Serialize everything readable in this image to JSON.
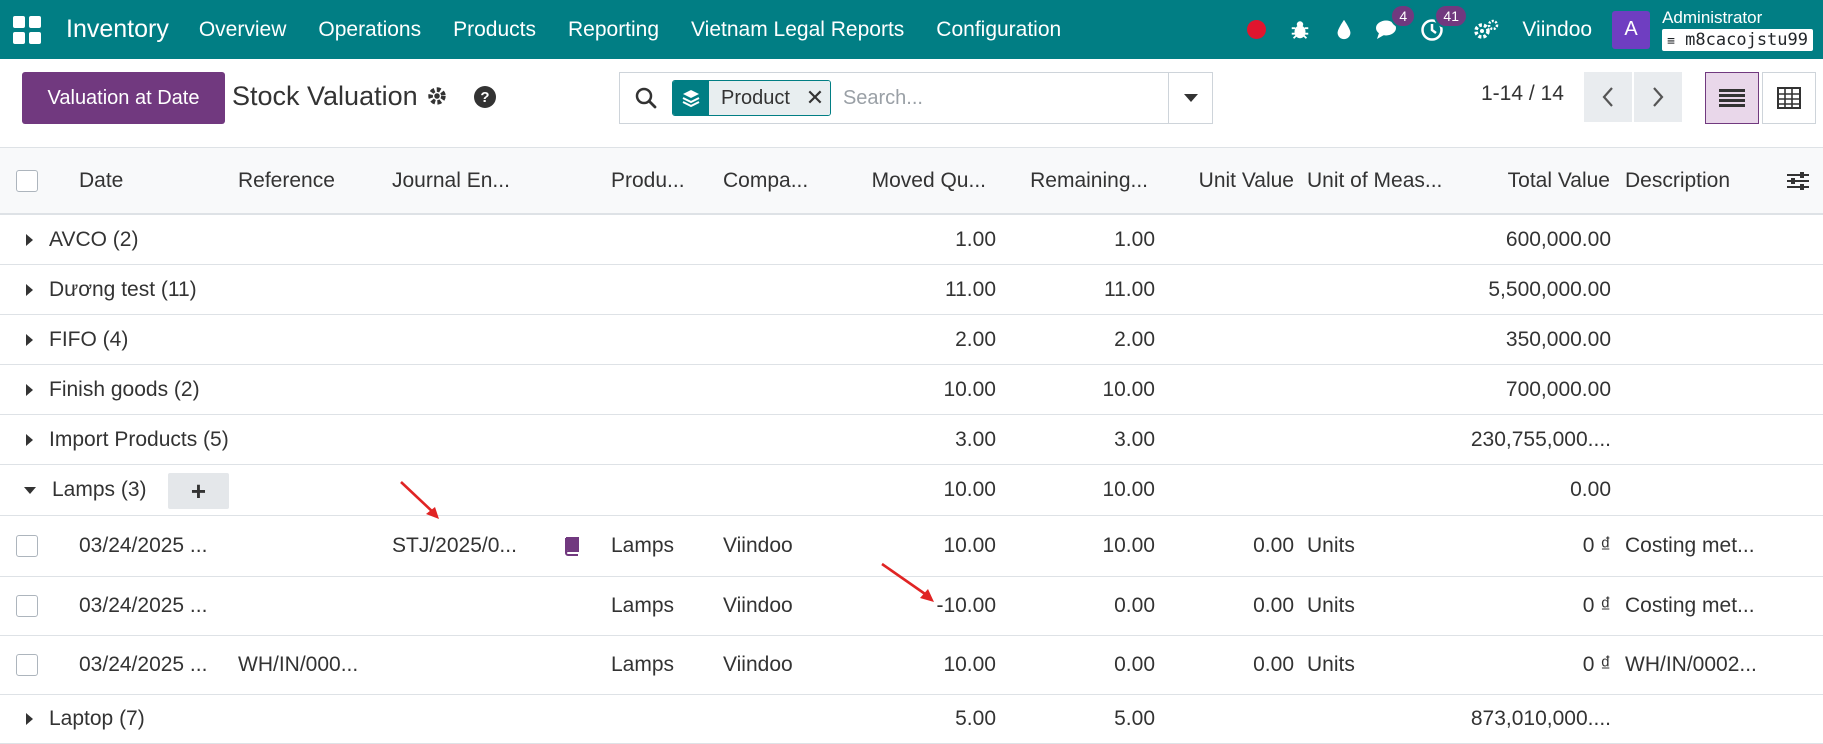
{
  "navbar": {
    "brand": "Inventory",
    "menu": [
      "Overview",
      "Operations",
      "Products",
      "Reporting",
      "Vietnam Legal Reports",
      "Configuration"
    ],
    "messages_count": "4",
    "activities_count": "41",
    "company": "Viindoo",
    "avatar_letter": "A",
    "user": "Administrator",
    "database": "m8cacojstu99"
  },
  "control": {
    "primary_button": "Valuation at Date",
    "title": "Stock Valuation",
    "facet_label": "Product",
    "search_placeholder": "Search...",
    "pager": "1-14 / 14"
  },
  "columns": {
    "date": "Date",
    "reference": "Reference",
    "journal_entry": "Journal En...",
    "product": "Produ...",
    "company": "Compa...",
    "moved_qty": "Moved Qu...",
    "remaining": "Remaining...",
    "unit_value": "Unit Value",
    "uom": "Unit of Meas...",
    "total_value": "Total Value",
    "description": "Description"
  },
  "groups_before": [
    {
      "label": "AVCO (2)",
      "moved": "1.00",
      "remaining": "1.00",
      "total": "600,000.00"
    },
    {
      "label": "Dương test (11)",
      "moved": "11.00",
      "remaining": "11.00",
      "total": "5,500,000.00"
    },
    {
      "label": "FIFO (4)",
      "moved": "2.00",
      "remaining": "2.00",
      "total": "350,000.00"
    },
    {
      "label": "Finish goods (2)",
      "moved": "10.00",
      "remaining": "10.00",
      "total": "700,000.00"
    },
    {
      "label": "Import Products (5)",
      "moved": "3.00",
      "remaining": "3.00",
      "total": "230,755,000...."
    }
  ],
  "open_group": {
    "label": "Lamps (3)",
    "moved": "10.00",
    "remaining": "10.00",
    "total": "0.00"
  },
  "records": [
    {
      "date": "03/24/2025 ...",
      "reference": "",
      "journal": "STJ/2025/0...",
      "product": "Lamps",
      "company": "Viindoo",
      "moved": "10.00",
      "remaining": "10.00",
      "unit_value": "0.00",
      "uom": "Units",
      "total": "0 ₫",
      "description": "Costing met..."
    },
    {
      "date": "03/24/2025 ...",
      "reference": "",
      "journal": "",
      "product": "Lamps",
      "company": "Viindoo",
      "moved": "-10.00",
      "remaining": "0.00",
      "unit_value": "0.00",
      "uom": "Units",
      "total": "0 ₫",
      "description": "Costing met..."
    },
    {
      "date": "03/24/2025 ...",
      "reference": "WH/IN/000...",
      "journal": "",
      "product": "Lamps",
      "company": "Viindoo",
      "moved": "10.00",
      "remaining": "0.00",
      "unit_value": "0.00",
      "uom": "Units",
      "total": "0 ₫",
      "description": "WH/IN/0002..."
    }
  ],
  "groups_after": [
    {
      "label": "Laptop (7)",
      "moved": "5.00",
      "remaining": "5.00",
      "total": "873,010,000...."
    }
  ],
  "colors": {
    "brand": "#017e84",
    "primary": "#71397f",
    "arrow": "#e02424"
  }
}
